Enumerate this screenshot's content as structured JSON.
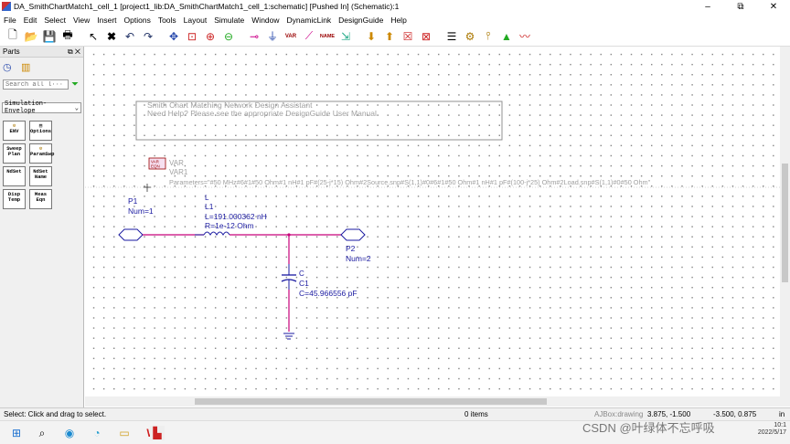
{
  "window": {
    "title": "DA_SmithChartMatch1_cell_1 [project1_lib:DA_SmithChartMatch1_cell_1:schematic] [Pushed In] (Schematic):1",
    "restore_glyph": "⧉",
    "close_glyph": "✕"
  },
  "menu": [
    "File",
    "Edit",
    "Select",
    "View",
    "Insert",
    "Options",
    "Tools",
    "Layout",
    "Simulate",
    "Window",
    "DynamicLink",
    "DesignGuide",
    "Help"
  ],
  "toolbar": {
    "var_label": "VAR",
    "name_label": "NAME"
  },
  "parts": {
    "title": "Parts",
    "search_placeholder": "Search all l···",
    "library": "Simulation-Envelope",
    "palette": [
      {
        "label": "ENV"
      },
      {
        "label": "Options"
      },
      {
        "label": "Sweep Plan"
      },
      {
        "label": "ParamSwp"
      },
      {
        "label": "NdSet"
      },
      {
        "label": "NdSet Name"
      },
      {
        "label": "Disp Temp"
      },
      {
        "label": "Meas Eqn"
      }
    ]
  },
  "schematic": {
    "designguide_box": {
      "line1": "Smith Chart Matching Network Design Assistant",
      "line2": "Need Help?  Please see the appropriate DesignGuide User Manual"
    },
    "var": {
      "icon_text_1": "VAR",
      "icon_text_2": "EQN",
      "label1": "VAR",
      "label2": "VAR1",
      "params": "Parameters=\"#50 MHz#6#1#50 Ohm#1 nH#1 pF#(25-j*15) Ohm#2Source.snp#S(1,1)#0#6#1#50 Ohm#1 nH#1 pF#(100-j*25) Ohm#2Load.snp#S(1,1)#0#50 Ohm\""
    },
    "port1": {
      "name": "P1",
      "num": "Num=1"
    },
    "port2": {
      "name": "P2",
      "num": "Num=2"
    },
    "inductor": {
      "type": "L",
      "name": "L1",
      "value": "L=191.000362 nH",
      "resistance": "R=1e-12 Ohm"
    },
    "capacitor": {
      "type": "C",
      "name": "C1",
      "value": "C=45.966556 pF"
    }
  },
  "status": {
    "message": "Select: Click and drag to select.",
    "items": "0 items",
    "mode": "AJBox:drawing",
    "coord1": "3.875, -1.500",
    "coord2": "-3.500, 0.875",
    "units": "in"
  },
  "taskbar": {
    "watermark": "CSDN @叶绿体不忘呼吸",
    "time": "10:1",
    "date": "2022/5/17"
  },
  "colors": {
    "wire": "#c8007a",
    "component": "#1a1aa0",
    "port": "#1a1aa0",
    "faint_text": "#a0a0a0"
  }
}
